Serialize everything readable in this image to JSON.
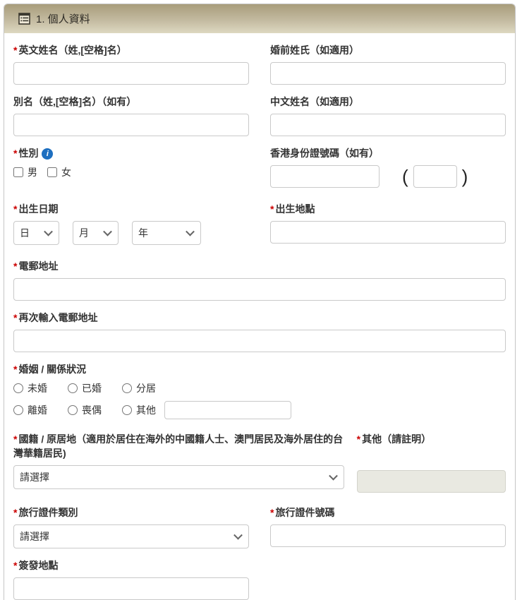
{
  "header": {
    "title": "1. 個人資料"
  },
  "misc": {
    "required_marker": "*",
    "paren_open": "(",
    "paren_close": ")",
    "info_glyph": "i"
  },
  "fields": {
    "english_name": {
      "label": "英文姓名（姓,[空格]名）",
      "value": ""
    },
    "maiden_name": {
      "label": "婚前姓氏（如適用）",
      "value": ""
    },
    "alias": {
      "label": "別名（姓,[空格]名）（如有）",
      "value": ""
    },
    "chinese_name": {
      "label": "中文姓名（如適用）",
      "value": ""
    },
    "gender": {
      "label": "性別",
      "options": [
        "男",
        "女"
      ]
    },
    "hkid": {
      "label": "香港身份證號碼（如有）",
      "value": "",
      "check_digit": ""
    },
    "birth_date": {
      "label": "出生日期",
      "day_placeholder": "日",
      "month_placeholder": "月",
      "year_placeholder": "年"
    },
    "birth_place": {
      "label": "出生地點",
      "value": ""
    },
    "email": {
      "label": "電郵地址",
      "value": ""
    },
    "email_confirm": {
      "label": "再次輸入電郵地址",
      "value": ""
    },
    "marital_status": {
      "label": "婚姻 / 關係狀況",
      "options": [
        "未婚",
        "已婚",
        "分居",
        "離婚",
        "喪偶",
        "其他"
      ],
      "other_value": ""
    },
    "nationality": {
      "label": "國籍 / 原居地（適用於居住在海外的中國籍人士、澳門居民及海外居住的台灣華籍居民)",
      "selected": "請選擇"
    },
    "other_specify": {
      "label": "其他（請註明）",
      "value": "",
      "disabled": true
    },
    "travel_doc_type": {
      "label": "旅行證件類別",
      "selected": "請選擇"
    },
    "travel_doc_number": {
      "label": "旅行證件號碼",
      "value": ""
    },
    "issue_place": {
      "label": "簽發地點",
      "value": ""
    }
  },
  "colors": {
    "accent_red": "#cb0000",
    "info_blue": "#1e6fc0",
    "header_gradient_top": "#a89d7b",
    "header_gradient_bottom": "#ddd8c1",
    "input_border": "#c9c9c9",
    "disabled_bg": "#e9e9e1"
  }
}
